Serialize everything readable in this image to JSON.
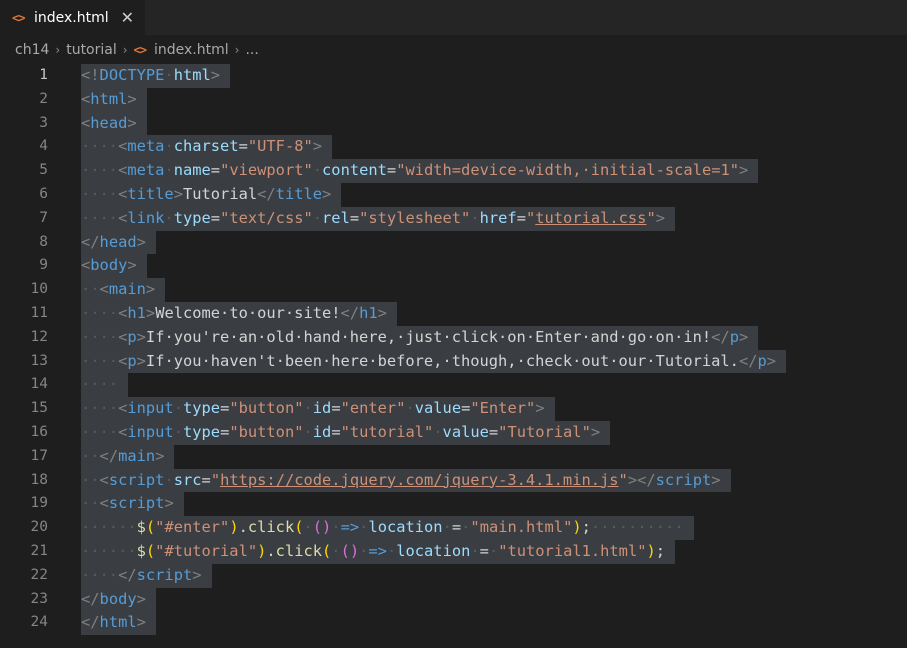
{
  "tab": {
    "icon": "<>",
    "label": "index.html",
    "close": "✕"
  },
  "breadcrumb": {
    "items": [
      "ch14",
      "tutorial",
      "index.html",
      "..."
    ],
    "separator": "›"
  },
  "editor": {
    "active_line": 1,
    "lines": [
      {
        "n": "1",
        "t": [
          [
            "br",
            "<!"
          ],
          [
            "tag",
            "DOCTYPE"
          ],
          [
            "ws",
            "·"
          ],
          [
            "attr",
            "html"
          ],
          [
            "br",
            ">"
          ]
        ]
      },
      {
        "n": "2",
        "t": [
          [
            "br",
            "<"
          ],
          [
            "tag",
            "html"
          ],
          [
            "br",
            ">"
          ]
        ]
      },
      {
        "n": "3",
        "t": [
          [
            "br",
            "<"
          ],
          [
            "tag",
            "head"
          ],
          [
            "br",
            ">"
          ]
        ]
      },
      {
        "n": "4",
        "t": [
          [
            "ws",
            "····"
          ],
          [
            "br",
            "<"
          ],
          [
            "tag",
            "meta"
          ],
          [
            "ws",
            "·"
          ],
          [
            "attr",
            "charset"
          ],
          [
            "txt",
            "="
          ],
          [
            "str",
            "\"UTF-8\""
          ],
          [
            "br",
            ">"
          ]
        ]
      },
      {
        "n": "5",
        "t": [
          [
            "ws",
            "····"
          ],
          [
            "br",
            "<"
          ],
          [
            "tag",
            "meta"
          ],
          [
            "ws",
            "·"
          ],
          [
            "attr",
            "name"
          ],
          [
            "txt",
            "="
          ],
          [
            "str",
            "\"viewport\""
          ],
          [
            "ws",
            "·"
          ],
          [
            "attr",
            "content"
          ],
          [
            "txt",
            "="
          ],
          [
            "str",
            "\"width=device-width,·initial-scale=1\""
          ],
          [
            "br",
            ">"
          ]
        ]
      },
      {
        "n": "6",
        "t": [
          [
            "ws",
            "····"
          ],
          [
            "br",
            "<"
          ],
          [
            "tag",
            "title"
          ],
          [
            "br",
            ">"
          ],
          [
            "txt",
            "Tutorial"
          ],
          [
            "br",
            "</"
          ],
          [
            "tag",
            "title"
          ],
          [
            "br",
            ">"
          ]
        ]
      },
      {
        "n": "7",
        "t": [
          [
            "ws",
            "····"
          ],
          [
            "br",
            "<"
          ],
          [
            "tag",
            "link"
          ],
          [
            "ws",
            "·"
          ],
          [
            "attr",
            "type"
          ],
          [
            "txt",
            "="
          ],
          [
            "str",
            "\"text/css\""
          ],
          [
            "ws",
            "·"
          ],
          [
            "attr",
            "rel"
          ],
          [
            "txt",
            "="
          ],
          [
            "str",
            "\"stylesheet\""
          ],
          [
            "ws",
            "·"
          ],
          [
            "attr",
            "href"
          ],
          [
            "txt",
            "="
          ],
          [
            "str",
            "\""
          ],
          [
            "url",
            "tutorial.css"
          ],
          [
            "str",
            "\""
          ],
          [
            "br",
            ">"
          ]
        ]
      },
      {
        "n": "8",
        "t": [
          [
            "br",
            "</"
          ],
          [
            "tag",
            "head"
          ],
          [
            "br",
            ">"
          ]
        ]
      },
      {
        "n": "9",
        "t": [
          [
            "br",
            "<"
          ],
          [
            "tag",
            "body"
          ],
          [
            "br",
            ">"
          ]
        ]
      },
      {
        "n": "10",
        "t": [
          [
            "ws",
            "··"
          ],
          [
            "br",
            "<"
          ],
          [
            "tag",
            "main"
          ],
          [
            "br",
            ">"
          ]
        ]
      },
      {
        "n": "11",
        "t": [
          [
            "ws",
            "····"
          ],
          [
            "br",
            "<"
          ],
          [
            "tag",
            "h1"
          ],
          [
            "br",
            ">"
          ],
          [
            "txt",
            "Welcome·to·our·site!"
          ],
          [
            "br",
            "</"
          ],
          [
            "tag",
            "h1"
          ],
          [
            "br",
            ">"
          ]
        ]
      },
      {
        "n": "12",
        "t": [
          [
            "ws",
            "····"
          ],
          [
            "br",
            "<"
          ],
          [
            "tag",
            "p"
          ],
          [
            "br",
            ">"
          ],
          [
            "txt",
            "If·you're·an·old·hand·here,·just·click·on·Enter·and·go·on·in!"
          ],
          [
            "br",
            "</"
          ],
          [
            "tag",
            "p"
          ],
          [
            "br",
            ">"
          ]
        ]
      },
      {
        "n": "13",
        "t": [
          [
            "ws",
            "····"
          ],
          [
            "br",
            "<"
          ],
          [
            "tag",
            "p"
          ],
          [
            "br",
            ">"
          ],
          [
            "txt",
            "If·you·haven't·been·here·before,·though,·check·out·our·Tutorial."
          ],
          [
            "br",
            "</"
          ],
          [
            "tag",
            "p"
          ],
          [
            "br",
            ">"
          ]
        ]
      },
      {
        "n": "14",
        "t": [
          [
            "ws",
            "····"
          ]
        ]
      },
      {
        "n": "15",
        "t": [
          [
            "ws",
            "····"
          ],
          [
            "br",
            "<"
          ],
          [
            "tag",
            "input"
          ],
          [
            "ws",
            "·"
          ],
          [
            "attr",
            "type"
          ],
          [
            "txt",
            "="
          ],
          [
            "str",
            "\"button\""
          ],
          [
            "ws",
            "·"
          ],
          [
            "attr",
            "id"
          ],
          [
            "txt",
            "="
          ],
          [
            "str",
            "\"enter\""
          ],
          [
            "ws",
            "·"
          ],
          [
            "attr",
            "value"
          ],
          [
            "txt",
            "="
          ],
          [
            "str",
            "\"Enter\""
          ],
          [
            "br",
            ">"
          ]
        ]
      },
      {
        "n": "16",
        "t": [
          [
            "ws",
            "····"
          ],
          [
            "br",
            "<"
          ],
          [
            "tag",
            "input"
          ],
          [
            "ws",
            "·"
          ],
          [
            "attr",
            "type"
          ],
          [
            "txt",
            "="
          ],
          [
            "str",
            "\"button\""
          ],
          [
            "ws",
            "·"
          ],
          [
            "attr",
            "id"
          ],
          [
            "txt",
            "="
          ],
          [
            "str",
            "\"tutorial\""
          ],
          [
            "ws",
            "·"
          ],
          [
            "attr",
            "value"
          ],
          [
            "txt",
            "="
          ],
          [
            "str",
            "\"Tutorial\""
          ],
          [
            "br",
            ">"
          ]
        ]
      },
      {
        "n": "17",
        "t": [
          [
            "ws",
            "··"
          ],
          [
            "br",
            "</"
          ],
          [
            "tag",
            "main"
          ],
          [
            "br",
            ">"
          ]
        ]
      },
      {
        "n": "18",
        "t": [
          [
            "ws",
            "··"
          ],
          [
            "br",
            "<"
          ],
          [
            "tag",
            "script"
          ],
          [
            "ws",
            "·"
          ],
          [
            "attr",
            "src"
          ],
          [
            "txt",
            "="
          ],
          [
            "str",
            "\""
          ],
          [
            "url",
            "https://code.jquery.com/jquery-3.4.1.min.js"
          ],
          [
            "str",
            "\""
          ],
          [
            "br",
            "></"
          ],
          [
            "tag",
            "script"
          ],
          [
            "br",
            ">"
          ]
        ]
      },
      {
        "n": "19",
        "t": [
          [
            "ws",
            "··"
          ],
          [
            "br",
            "<"
          ],
          [
            "tag",
            "script"
          ],
          [
            "br",
            ">"
          ]
        ]
      },
      {
        "n": "20",
        "t": [
          [
            "ws",
            "······"
          ],
          [
            "fn",
            "$"
          ],
          [
            "p1",
            "("
          ],
          [
            "str",
            "\"#enter\""
          ],
          [
            "p1",
            ")"
          ],
          [
            "txt",
            "."
          ],
          [
            "fn",
            "click"
          ],
          [
            "p1",
            "("
          ],
          [
            "ws",
            "·"
          ],
          [
            "p2",
            "()"
          ],
          [
            "ws",
            "·"
          ],
          [
            "kw",
            "=>"
          ],
          [
            "ws",
            "·"
          ],
          [
            "var",
            "location"
          ],
          [
            "ws",
            "·"
          ],
          [
            "op",
            "="
          ],
          [
            "ws",
            "·"
          ],
          [
            "str",
            "\"main.html\""
          ],
          [
            "p1",
            ")"
          ],
          [
            "txt",
            ";"
          ],
          [
            "ws",
            "··········"
          ]
        ]
      },
      {
        "n": "21",
        "t": [
          [
            "ws",
            "······"
          ],
          [
            "fn",
            "$"
          ],
          [
            "p1",
            "("
          ],
          [
            "str",
            "\"#tutorial\""
          ],
          [
            "p1",
            ")"
          ],
          [
            "txt",
            "."
          ],
          [
            "fn",
            "click"
          ],
          [
            "p1",
            "("
          ],
          [
            "ws",
            "·"
          ],
          [
            "p2",
            "()"
          ],
          [
            "ws",
            "·"
          ],
          [
            "kw",
            "=>"
          ],
          [
            "ws",
            "·"
          ],
          [
            "var",
            "location"
          ],
          [
            "ws",
            "·"
          ],
          [
            "op",
            "="
          ],
          [
            "ws",
            "·"
          ],
          [
            "str",
            "\"tutorial1.html\""
          ],
          [
            "p1",
            ")"
          ],
          [
            "txt",
            ";"
          ]
        ]
      },
      {
        "n": "22",
        "t": [
          [
            "ws",
            "····"
          ],
          [
            "br",
            "</"
          ],
          [
            "tag",
            "script"
          ],
          [
            "br",
            ">"
          ]
        ]
      },
      {
        "n": "23",
        "t": [
          [
            "br",
            "</"
          ],
          [
            "tag",
            "body"
          ],
          [
            "br",
            ">"
          ]
        ]
      },
      {
        "n": "24",
        "t": [
          [
            "br",
            "</"
          ],
          [
            "tag",
            "html"
          ],
          [
            "br",
            ">"
          ]
        ]
      }
    ]
  }
}
